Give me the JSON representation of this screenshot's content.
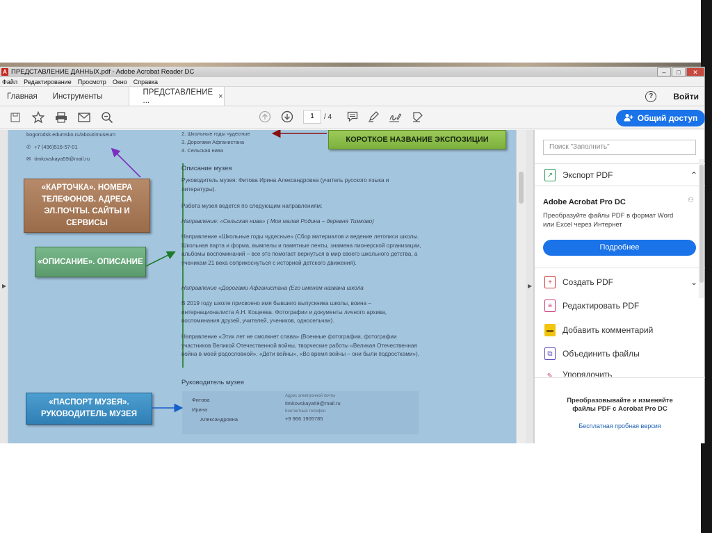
{
  "window": {
    "title": "ПРЕДСТАВЛЕНИЕ ДАННЫХ.pdf - Adobe Acrobat Reader DC",
    "min": "‒",
    "max": "□",
    "close": "✕"
  },
  "menu": [
    "Файл",
    "Редактирование",
    "Просмотр",
    "Окно",
    "Справка"
  ],
  "tabs": {
    "home": "Главная",
    "tools": "Инструменты",
    "document": "ПРЕДСТАВЛЕНИЕ ...",
    "close": "×",
    "help": "?",
    "signin": "Войти"
  },
  "toolbar": {
    "page_current": "1",
    "page_total": "/ 4",
    "share_label": "Общий доступ",
    "icons": [
      "save-icon",
      "star-icon",
      "print-icon",
      "mail-icon",
      "search-icon",
      "page-up-icon",
      "page-down-icon",
      "comment-icon",
      "highlight-icon",
      "sign-icon",
      "fill-sign-icon",
      "user-add-icon"
    ]
  },
  "pdf": {
    "contacts": [
      "bogorodsk.edumsko.ru/about/museum",
      "+7 (496)516-57-01",
      "timkovskaya59@mail.ru"
    ],
    "directions_list": [
      "2. Школьные годы чудесные",
      "3. Дорогами Афганистана",
      "4. Сельская нива"
    ],
    "description_heading": "Описание музея",
    "p1": "Руководитель музея: Фитова Ирина Александровна  (учитель русского языка и литературы).",
    "p2": "Работа музея ведется по следующим  направлениям:",
    "p3": "Направление: «Сельская нива» ( Моя малая Родина – деревня Тимково)",
    "p4": "Направление «Школьные годы чудесные» (Сбор материалов и ведение летописи школы. Школьная парта и форма, вымпелы и памятные ленты, знамена пионерской организации, альбомы воспоминаний – все это помогает вернуться в мир своего школьного детства, а ученикам 21 века соприкоснуться с историей детского движения).",
    "p5": "Направление «Дорогами Афганистана (Его именем названа школа",
    "p6": "В 2019 году школе присвоено имя бывшего выпускника школы, воина – интернационалиста А.Н. Кощеева. Фотографии и документы личного архива, воспоминания друзей, учителей, учеников, односельчан).",
    "p7": "Направление «Этих лет не смолкнет слава» (Военные фотографии, фотографии участников Великой Отечественной войны, творческие работы «Великая Отечественная война в моей родословной», «Дети войны», «Во время войны – они были подростками»).",
    "leader_heading": "Руководитель музея",
    "leader_name": [
      "Фитова",
      "Ирина",
      "Александровна"
    ],
    "email_label": "Адрес электронной почты",
    "email_value": "timkovskaya59@mail.ru",
    "phone_label": "Контактный телефон",
    "phone_value": "+9 966 1905785"
  },
  "callouts": {
    "card": "«КАРТОЧКА». НОМЕРА ТЕЛЕФОНОВ. АДРЕСА ЭЛ.ПОЧТЫ. САЙТЫ И СЕРВИСЫ",
    "description": "«ОПИСАНИЕ». ОПИСАНИЕ",
    "passport": "«ПАСПОРТ МУЗЕЯ». РУКОВОДИТЕЛЬ МУЗЕЯ",
    "short_name": "КОРОТКОЕ НАЗВАНИЕ ЭКСПОЗИЦИИ"
  },
  "right_panel": {
    "search_placeholder": "Поиск \"Заполнить\"",
    "export_pdf": "Экспорт PDF",
    "pro_title": "Adobe Acrobat Pro DC",
    "pro_desc": "Преобразуйте файлы PDF в формат Word или Excel через Интернет",
    "more_button": "Подробнее",
    "tools": [
      "Создать PDF",
      "Редактировать PDF",
      "Добавить комментарий",
      "Объединить файлы",
      "Упорядочить"
    ],
    "footer_text": "Преобразовывайте и изменяйте файлы PDF с Acrobat Pro DC",
    "trial_link": "Бесплатная пробная версия"
  },
  "colors": {
    "accent": "#1a73e8",
    "doc_bg": "#a3c5de",
    "callout_brown": "#9a6c4a",
    "callout_green": "#5a9a6c",
    "callout_blue": "#2f7fb5",
    "callout_yellowgreen": "#7cb13c"
  }
}
